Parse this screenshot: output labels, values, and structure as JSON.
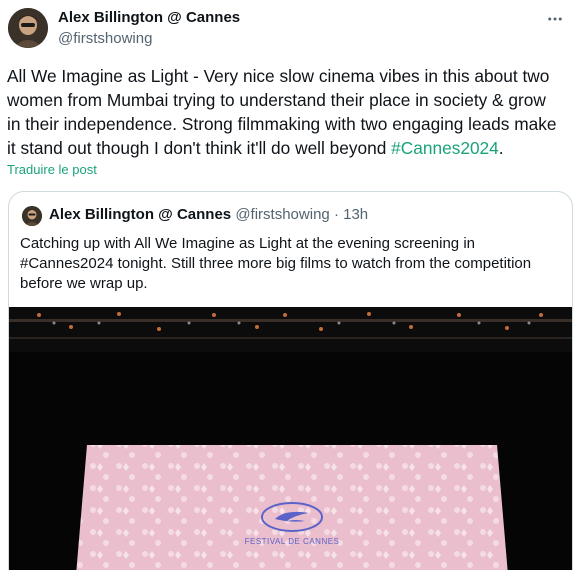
{
  "post": {
    "author_name": "Alex Billington @ Cannes",
    "author_handle": "@firstshowing",
    "text_lines": [
      "All We Imagine as Light - Very nice slow cinema vibes in this about two",
      "women from Mumbai trying to understand their place in society & grow",
      "in their independence. Strong filmmaking with two engaging leads make",
      "it stand out though I don't think it'll do well beyond "
    ],
    "hashtag": "#Cannes2024",
    "text_end": ".",
    "translate_label": "Traduire le post"
  },
  "quote": {
    "author_name": "Alex Billington @ Cannes",
    "author_handle": "@firstshowing",
    "separator": "·",
    "time": "13h",
    "text_lines": [
      "Catching up with All We Imagine as Light at the evening screening in",
      "#Cannes2024 tonight. Still three more big films to watch from the competition",
      "before we wrap up."
    ],
    "media": {
      "screen_text": "FESTIVAL DE CANNES",
      "screen_color": "#e9b7c9"
    }
  },
  "icons": {
    "more": "more-horizontal-icon",
    "avatar": "user-avatar"
  }
}
